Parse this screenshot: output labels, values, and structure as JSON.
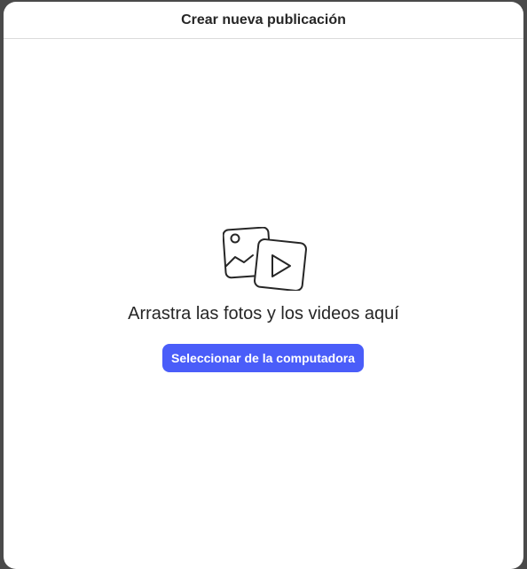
{
  "modal": {
    "title": "Crear nueva publicación",
    "drop_text": "Arrastra las fotos y los videos aquí",
    "select_button_label": "Seleccionar de la computadora",
    "icon": "photo-video-icon"
  },
  "colors": {
    "backdrop": "#4a4a4a",
    "modal_bg": "#ffffff",
    "button_bg": "#4a5df9",
    "button_text": "#ffffff",
    "text": "#262626",
    "divider": "#dbdbdb"
  }
}
